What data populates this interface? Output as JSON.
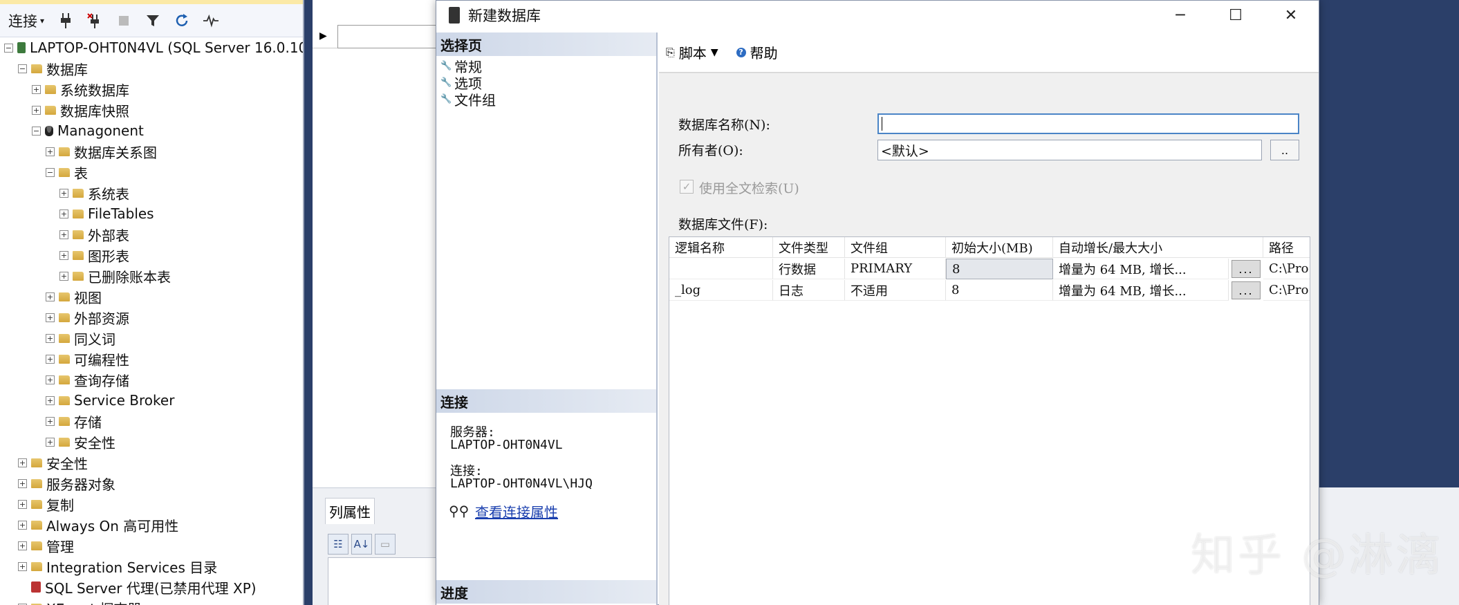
{
  "object_explorer": {
    "toolbar": {
      "connect_label": "连接",
      "icons": [
        "plug-icon",
        "disconnect-icon",
        "stop-icon",
        "filter-icon",
        "refresh-icon",
        "activity-icon"
      ]
    },
    "tree": [
      {
        "label": "LAPTOP-OHT0N4VL (SQL Server 16.0.10",
        "level": 0,
        "state": "-",
        "icon": "server"
      },
      {
        "label": "数据库",
        "level": 1,
        "state": "-",
        "icon": "folder"
      },
      {
        "label": "系统数据库",
        "level": 2,
        "state": "+",
        "icon": "folder"
      },
      {
        "label": "数据库快照",
        "level": 2,
        "state": "+",
        "icon": "folder"
      },
      {
        "label": "Managonent",
        "level": 2,
        "state": "-",
        "icon": "db"
      },
      {
        "label": "数据库关系图",
        "level": 3,
        "state": "+",
        "icon": "folder"
      },
      {
        "label": "表",
        "level": 3,
        "state": "-",
        "icon": "folder"
      },
      {
        "label": "系统表",
        "level": 4,
        "state": "+",
        "icon": "folder"
      },
      {
        "label": "FileTables",
        "level": 4,
        "state": "+",
        "icon": "folder"
      },
      {
        "label": "外部表",
        "level": 4,
        "state": "+",
        "icon": "folder"
      },
      {
        "label": "图形表",
        "level": 4,
        "state": "+",
        "icon": "folder"
      },
      {
        "label": "已删除账本表",
        "level": 4,
        "state": "+",
        "icon": "folder"
      },
      {
        "label": "视图",
        "level": 3,
        "state": "+",
        "icon": "folder"
      },
      {
        "label": "外部资源",
        "level": 3,
        "state": "+",
        "icon": "folder"
      },
      {
        "label": "同义词",
        "level": 3,
        "state": "+",
        "icon": "folder"
      },
      {
        "label": "可编程性",
        "level": 3,
        "state": "+",
        "icon": "folder"
      },
      {
        "label": "查询存储",
        "level": 3,
        "state": "+",
        "icon": "folder"
      },
      {
        "label": "Service Broker",
        "level": 3,
        "state": "+",
        "icon": "folder"
      },
      {
        "label": "存储",
        "level": 3,
        "state": "+",
        "icon": "folder"
      },
      {
        "label": "安全性",
        "level": 3,
        "state": "+",
        "icon": "folder"
      },
      {
        "label": "安全性",
        "level": 1,
        "state": "+",
        "icon": "folder"
      },
      {
        "label": "服务器对象",
        "level": 1,
        "state": "+",
        "icon": "folder"
      },
      {
        "label": "复制",
        "level": 1,
        "state": "+",
        "icon": "folder"
      },
      {
        "label": "Always On 高可用性",
        "level": 1,
        "state": "+",
        "icon": "folder"
      },
      {
        "label": "管理",
        "level": 1,
        "state": "+",
        "icon": "folder"
      },
      {
        "label": "Integration Services 目录",
        "level": 1,
        "state": "+",
        "icon": "folder"
      },
      {
        "label": "SQL Server 代理(已禁用代理 XP)",
        "level": 1,
        "state": "",
        "icon": "agent"
      },
      {
        "label": "XEvent 探查器",
        "level": 1,
        "state": "+",
        "icon": "folder"
      }
    ]
  },
  "background": {
    "column_properties_tab": "列属性",
    "toolbar_icons": [
      "categorized-icon",
      "alphabetical-icon",
      "property-pages-icon"
    ]
  },
  "dialog": {
    "title": "新建数据库",
    "window_buttons": {
      "minimize": "─",
      "maximize": "☐",
      "close": "✕"
    },
    "select_page_header": "选择页",
    "pages": [
      "常规",
      "选项",
      "文件组"
    ],
    "connection_header": "连接",
    "server_label": "服务器:",
    "server_value": "LAPTOP-OHT0N4VL",
    "connection_label": "连接:",
    "connection_value": "LAPTOP-OHT0N4VL\\HJQ",
    "view_connection_link": "查看连接属性",
    "progress_header": "进度",
    "toolbar": {
      "script_label": "脚本",
      "help_label": "帮助"
    },
    "form": {
      "db_name_label": "数据库名称(N):",
      "db_name_value": "",
      "owner_label": "所有者(O):",
      "owner_value": "<默认>",
      "browse_button": "..",
      "fulltext_label": "使用全文检索(U)",
      "fulltext_checked": true,
      "files_label": "数据库文件(F):"
    },
    "files_table": {
      "columns": [
        "逻辑名称",
        "文件类型",
        "文件组",
        "初始大小(MB)",
        "自动增长/最大大小",
        "路径"
      ],
      "rows": [
        {
          "logical_name": "",
          "type": "行数据",
          "filegroup": "PRIMARY",
          "size": "8",
          "autogrow": "增量为 64 MB, 增长...",
          "grow_button": "...",
          "path": "C:\\Pro"
        },
        {
          "logical_name": "_log",
          "type": "日志",
          "filegroup": "不适用",
          "size": "8",
          "autogrow": "增量为 64 MB, 增长...",
          "grow_button": "...",
          "path": "C:\\Pro"
        }
      ]
    }
  },
  "watermark": "知乎 @淋漓"
}
